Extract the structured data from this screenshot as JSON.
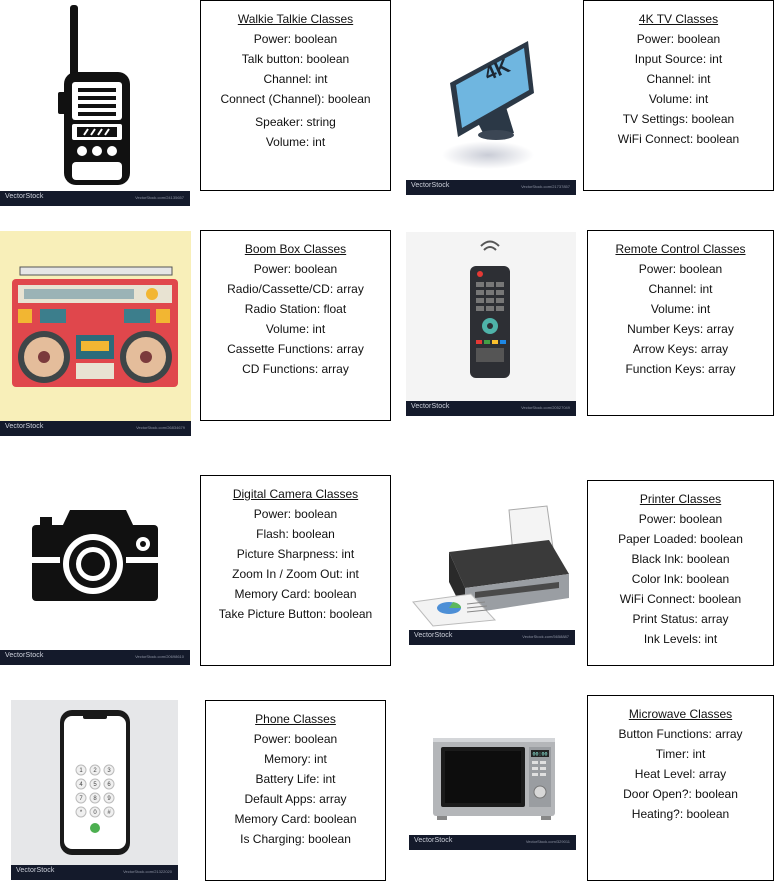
{
  "cards": [
    {
      "key": "walkie",
      "title": "Walkie Talkie Classes",
      "properties": [
        "Power: boolean",
        "Talk button: boolean",
        "Channel: int",
        "Connect (Channel): boolean",
        "Speaker: string",
        "Volume: int"
      ],
      "image": {
        "icon": "walkie-talkie-icon",
        "brand": "VectorStock",
        "url": "VectorStock.com/24135657"
      }
    },
    {
      "key": "tv",
      "title": "4K TV Classes",
      "properties": [
        "Power: boolean",
        "Input Source: int",
        "Channel: int",
        "Volume: int",
        "TV Settings: boolean",
        "WiFi Connect: boolean"
      ],
      "image": {
        "icon": "4k-tv-icon",
        "screen_text": "4K",
        "brand": "VectorStock",
        "url": "VectorStock.com/21737857"
      }
    },
    {
      "key": "boombox",
      "title": "Boom Box Classes",
      "properties": [
        "Power: boolean",
        "Radio/Cassette/CD: array",
        "Radio Station: float",
        "Volume: int",
        "Cassette Functions: array",
        "CD Functions: array"
      ],
      "image": {
        "icon": "boom-box-icon",
        "brand": "VectorStock",
        "url": "VectorStock.com/26834679"
      }
    },
    {
      "key": "remote",
      "title": "Remote Control Classes",
      "properties": [
        "Power: boolean",
        "Channel: int",
        "Volume: int",
        "Number Keys: array",
        "Arrow Keys: array",
        "Function Keys: array"
      ],
      "image": {
        "icon": "remote-control-icon",
        "brand": "VectorStock",
        "url": "VectorStock.com/20527049"
      }
    },
    {
      "key": "camera",
      "title": "Digital Camera Classes",
      "properties": [
        "Power: boolean",
        "Flash: boolean",
        "Picture Sharpness: int",
        "Zoom In / Zoom Out: int",
        "Memory Card: boolean",
        "Take Picture Button: boolean"
      ],
      "image": {
        "icon": "camera-icon",
        "brand": "VectorStock",
        "url": "VectorStock.com/20698610"
      }
    },
    {
      "key": "printer",
      "title": "Printer Classes",
      "properties": [
        "Power: boolean",
        "Paper Loaded: boolean",
        "Black Ink: boolean",
        "Color Ink: boolean",
        "WiFi Connect: boolean",
        "Print Status: array",
        "Ink Levels: int"
      ],
      "image": {
        "icon": "printer-icon",
        "brand": "VectorStock",
        "url": "VectorStock.com/5658887"
      }
    },
    {
      "key": "phone",
      "title": "Phone Classes",
      "properties": [
        "Power: boolean",
        "Memory: int",
        "Battery Life: int",
        "Default Apps: array",
        "Memory Card: boolean",
        "Is Charging: boolean"
      ],
      "image": {
        "icon": "smartphone-icon",
        "keypad": [
          "1",
          "2",
          "3",
          "4",
          "5",
          "6",
          "7",
          "8",
          "9",
          "*",
          "0",
          "#"
        ],
        "brand": "VectorStock",
        "url": "VectorStock.com/21322020"
      }
    },
    {
      "key": "microwave",
      "title": "Microwave Classes",
      "properties": [
        "Button Functions: array",
        "Timer: int",
        "Heat Level: array",
        "Door Open?: boolean",
        "Heating?: boolean"
      ],
      "image": {
        "icon": "microwave-icon",
        "display_text": "00:00",
        "brand": "VectorStock",
        "url": "VectorStock.com/329011"
      }
    }
  ]
}
